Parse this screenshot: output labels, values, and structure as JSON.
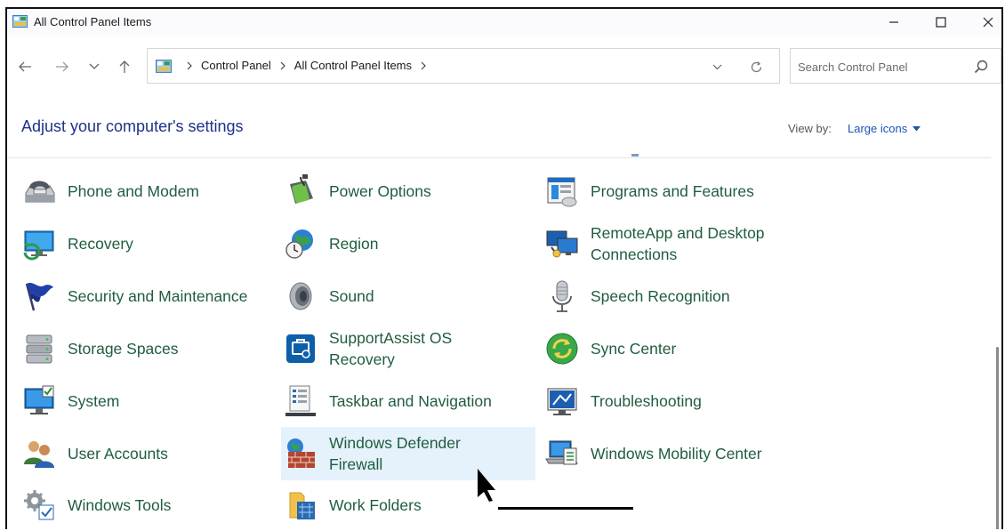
{
  "window": {
    "title": "All Control Panel Items"
  },
  "address": {
    "crumbs": [
      "Control Panel",
      "All Control Panel Items"
    ]
  },
  "search": {
    "placeholder": "Search Control Panel"
  },
  "header": {
    "title": "Adjust your computer's settings",
    "view_by_label": "View by:",
    "view_by_value": "Large icons"
  },
  "items": {
    "phone_modem": "Phone and Modem",
    "power_options": "Power Options",
    "programs_features": "Programs and Features",
    "recovery": "Recovery",
    "region": "Region",
    "remoteapp_line1": "RemoteApp and Desktop",
    "remoteapp_line2": "Connections",
    "security_maintenance": "Security and Maintenance",
    "sound": "Sound",
    "speech_recognition": "Speech Recognition",
    "storage_spaces": "Storage Spaces",
    "supportassist_line1": "SupportAssist OS",
    "supportassist_line2": "Recovery",
    "sync_center": "Sync Center",
    "system": "System",
    "taskbar_navigation": "Taskbar and Navigation",
    "troubleshooting": "Troubleshooting",
    "user_accounts": "User Accounts",
    "defender_line1": "Windows Defender",
    "defender_line2": "Firewall",
    "mobility_center": "Windows Mobility Center",
    "windows_tools": "Windows Tools",
    "work_folders": "Work Folders"
  },
  "colors": {
    "item_text": "#1f5d3f",
    "title_text": "#1e3287",
    "link_text": "#1a55b0",
    "hover_bg": "#e5f1fb"
  }
}
